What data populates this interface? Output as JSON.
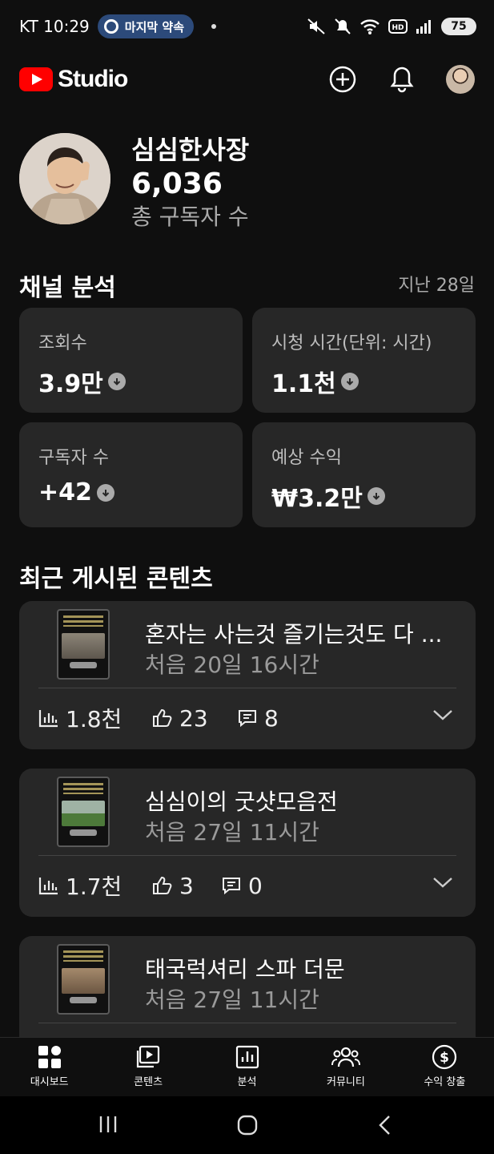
{
  "status_bar": {
    "carrier_time": "KT 10:29",
    "pill_label": "마지막 약속",
    "battery": "75"
  },
  "header": {
    "logo_text": "Studio",
    "icons": [
      "add-circle-icon",
      "bell-icon",
      "avatar"
    ]
  },
  "channel": {
    "name": "심심한사장",
    "subscribers": "6,036",
    "subscribers_label": "총 구독자 수"
  },
  "analytics": {
    "title": "채널 분석",
    "period": "지난 28일",
    "cards": [
      {
        "label": "조회수",
        "value": "3.9만",
        "trend": "down"
      },
      {
        "label": "시청 시간(단위: 시간)",
        "value": "1.1천",
        "trend": "down"
      },
      {
        "label": "구독자 수",
        "value": "+42",
        "trend": "down"
      },
      {
        "label": "예상 수익",
        "value": "₩3.2만",
        "trend": "down"
      }
    ]
  },
  "recent": {
    "title": "최근 게시된 콘텐츠",
    "videos": [
      {
        "title": "혼자는 사는것 즐기는것도 다 ...",
        "time": "처음 20일 16시간",
        "views": "1.8천",
        "likes": "23",
        "comments": "8"
      },
      {
        "title": "심심이의 굿샷모음전",
        "time": "처음 27일 11시간",
        "views": "1.7천",
        "likes": "3",
        "comments": "0"
      },
      {
        "title": "태국럭셔리 스파 더문",
        "time": "처음 27일 11시간"
      }
    ]
  },
  "bottom_nav": [
    {
      "label": "대시보드",
      "icon": "dashboard-icon",
      "active": true
    },
    {
      "label": "콘텐츠",
      "icon": "content-icon"
    },
    {
      "label": "분석",
      "icon": "analytics-icon"
    },
    {
      "label": "커뮤니티",
      "icon": "community-icon"
    },
    {
      "label": "수익 창출",
      "icon": "monetization-icon"
    }
  ],
  "system_nav": [
    "recents-icon",
    "home-icon",
    "back-icon"
  ],
  "colors": {
    "background": "#0f0f0f",
    "card": "#272727",
    "brand_red": "#ff0000",
    "muted_text": "#aaaaaa"
  }
}
